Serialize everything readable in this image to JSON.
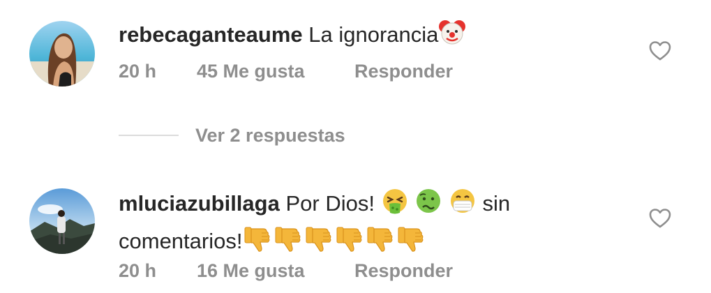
{
  "comments": [
    {
      "username": "rebecaganteaume",
      "text": "La ignorancia",
      "emoji_after": [
        "clown-face-emoji"
      ],
      "time": "20 h",
      "likes": "45 Me gusta",
      "reply_label": "Responder",
      "view_replies": "Ver 2 respuestas"
    },
    {
      "username": "mluciazubillaga",
      "text_part1": "Por Dios!",
      "emoji_middle": [
        "nauseated-face-emoji",
        "green-sick-face-emoji",
        "medical-mask-face-emoji"
      ],
      "text_part2": "sin",
      "text_line2": "comentarios!",
      "emoji_line2": [
        "thumbs-down-emoji",
        "thumbs-down-emoji",
        "thumbs-down-emoji",
        "thumbs-down-emoji",
        "thumbs-down-emoji",
        "thumbs-down-emoji"
      ],
      "time": "20 h",
      "likes": "16 Me gusta",
      "reply_label": "Responder"
    }
  ],
  "icons": {
    "like": "heart-outline-icon"
  },
  "colors": {
    "text": "#262626",
    "secondary": "#8e8e8e",
    "divider": "#dbdbdb"
  }
}
